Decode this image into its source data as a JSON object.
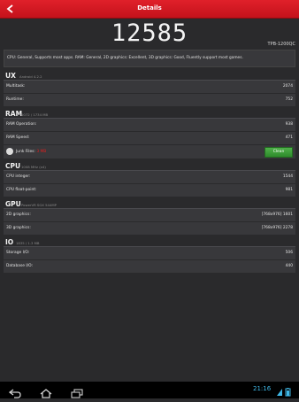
{
  "header": {
    "title": "Details"
  },
  "result": {
    "score": "12585",
    "model": "TPB-1200QC"
  },
  "summary": "CPU: General, Supports most apps. RAM: General, 2D graphics: Excellent, 3D graphics: Good, Fluently support most games.",
  "categories": {
    "ux": {
      "name": "UX",
      "sub": "Android 4.2.2",
      "rows": [
        {
          "label": "Multitask:",
          "value": "2074"
        },
        {
          "label": "Runtime:",
          "value": "752"
        }
      ]
    },
    "ram": {
      "name": "RAM",
      "sub": "1072 / 1734 MB",
      "rows": [
        {
          "label": "RAM Operation:",
          "value": "938"
        },
        {
          "label": "RAM Speed:",
          "value": "471"
        }
      ],
      "junk_label": "Junk Files:",
      "junk_value": "3 MB",
      "clean_label": "Clean"
    },
    "cpu": {
      "name": "CPU",
      "sub": "1008 MHz (x4)",
      "rows": [
        {
          "label": "CPU integer:",
          "value": "1544"
        },
        {
          "label": "CPU float-point:",
          "value": "981"
        }
      ]
    },
    "gpu": {
      "name": "GPU",
      "sub": "PowerVR SGX 544MP",
      "rows": [
        {
          "label": "2D graphics:",
          "value": "[768x976] 1601"
        },
        {
          "label": "3D graphics:",
          "value": "[768x976] 2278"
        }
      ]
    },
    "io": {
      "name": "IO",
      "sub": "1835 / 1.3 MB",
      "rows": [
        {
          "label": "Storage I/O:",
          "value": "506"
        },
        {
          "label": "Database I/O:",
          "value": "440"
        }
      ]
    }
  },
  "statusbar": {
    "time": "21:16"
  },
  "colors": {
    "accent": "#d0161f",
    "clean_button": "#3a9a35",
    "clock": "#3fb7e6"
  }
}
